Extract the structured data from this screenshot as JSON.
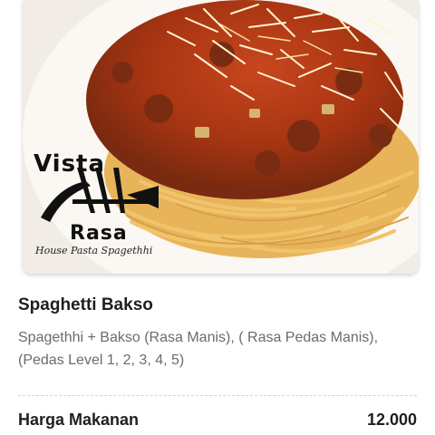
{
  "photo": {
    "logo_line1": "Vista",
    "logo_line2": "Rasa",
    "logo_tagline": "House Pasta Spagethhi"
  },
  "menu_item": {
    "title": "Spaghetti Bakso",
    "description": "Spagethhi + Bakso (Rasa Manis), ( Rasa Pedas Manis), (Pedas Level 1, 2, 3, 4, 5)"
  },
  "price": {
    "label": "Harga Makanan",
    "value": "12.000"
  }
}
